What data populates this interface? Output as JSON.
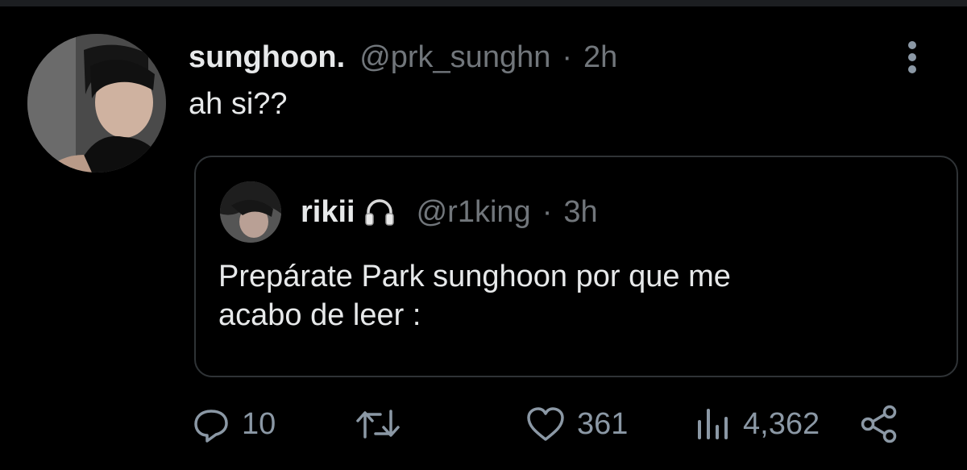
{
  "tweet": {
    "display_name": "sunghoon.",
    "handle": "@prk_sunghn",
    "separator": "·",
    "time": "2h",
    "text": "ah si??"
  },
  "quoted": {
    "display_name": "rikii",
    "name_emoji_icon": "headphones-icon",
    "handle": "@r1king",
    "separator": "·",
    "time": "3h",
    "text_line1": "Prepárate Park sunghoon por que me",
    "text_line2": "acabo de leer :"
  },
  "actions": {
    "replies": "10",
    "likes": "361",
    "views": "4,362"
  },
  "colors": {
    "background": "#000000",
    "primary_text": "#e7e9ea",
    "secondary_text": "#71767b",
    "icon": "#8b98a5",
    "border": "#2f3336"
  }
}
